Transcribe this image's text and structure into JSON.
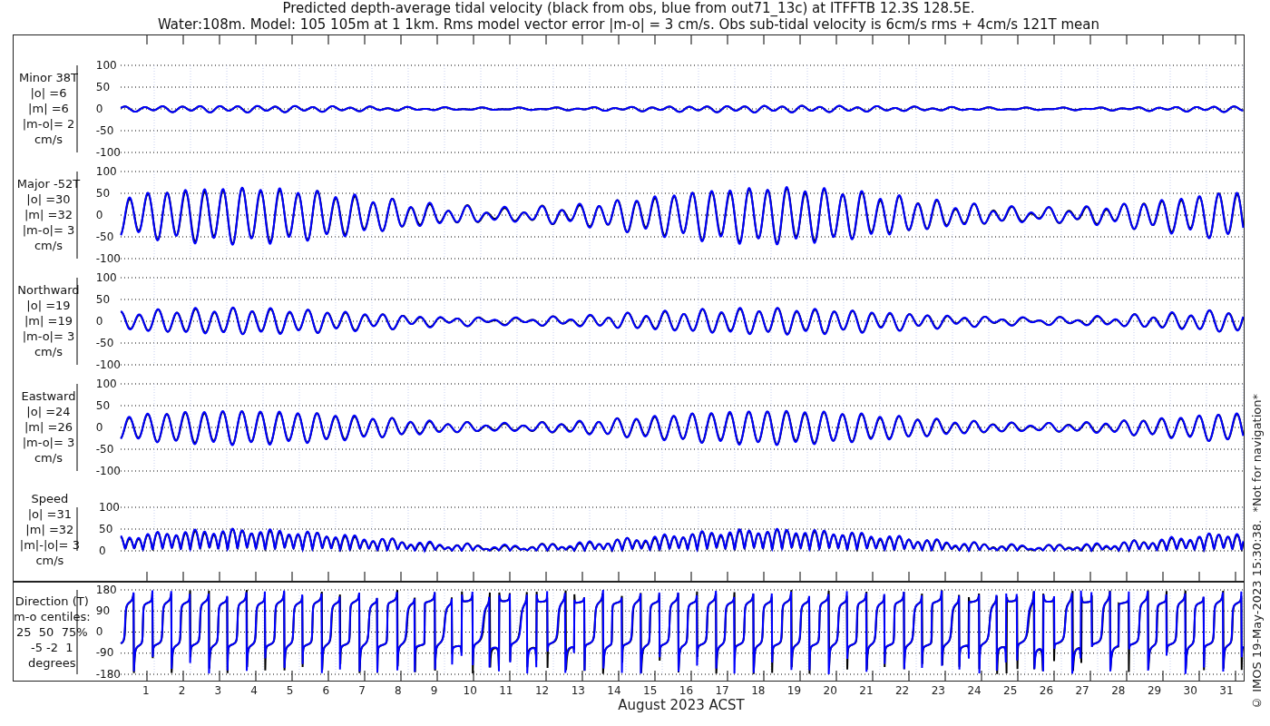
{
  "title_lines": [
    "Predicted depth-average tidal velocity (black from obs, blue from out71_13c) at ITFFTB 12.3S 128.5E.",
    "Water:108m. Model: 105 105m at 1 1km. Rms model vector error |m-o| = 3 cm/s. Obs sub-tidal velocity is 6cm/s rms + 4cm/s 121T mean"
  ],
  "panels": [
    {
      "kind": "minor",
      "label_lines": [
        "Minor 38T",
        "|o| =6",
        "|m| =6",
        "|m-o|= 2",
        "cm/s"
      ],
      "yticks": [
        "100",
        "50",
        "0",
        "-50",
        "-100"
      ]
    },
    {
      "kind": "major",
      "label_lines": [
        "Major -52T",
        "|o| =30",
        "|m| =32",
        "|m-o|= 3",
        "cm/s"
      ],
      "yticks": [
        "100",
        "50",
        "0",
        "-50",
        "-100"
      ]
    },
    {
      "kind": "north",
      "label_lines": [
        "Northward",
        "|o| =19",
        "|m| =19",
        "|m-o|= 3",
        "cm/s"
      ],
      "yticks": [
        "100",
        "50",
        "0",
        "-50",
        "-100"
      ]
    },
    {
      "kind": "east",
      "label_lines": [
        "Eastward",
        "|o| =24",
        "|m| =26",
        "|m-o|= 3",
        "cm/s"
      ],
      "yticks": [
        "100",
        "50",
        "0",
        "-50",
        "-100"
      ]
    },
    {
      "kind": "speed",
      "label_lines": [
        "Speed",
        "|o| =31",
        "|m| =32",
        "|m|-|o|= 3",
        "cm/s"
      ],
      "yticks": [
        "100",
        "50",
        "0"
      ]
    },
    {
      "kind": "direction",
      "label_lines": [
        "Direction (T)",
        "m-o centiles:",
        "25  50  75%",
        "-5 -2  1",
        "degrees"
      ],
      "yticks": [
        "180",
        "90",
        "0",
        "-90",
        "-180"
      ]
    }
  ],
  "x_axis": {
    "day_labels": [
      "1",
      "2",
      "3",
      "4",
      "5",
      "6",
      "7",
      "8",
      "9",
      "10",
      "11",
      "12",
      "13",
      "14",
      "15",
      "16",
      "17",
      "18",
      "19",
      "20",
      "21",
      "22",
      "23",
      "24",
      "25",
      "26",
      "27",
      "28",
      "29",
      "30",
      "31"
    ],
    "title": "August 2023 ACST"
  },
  "footer_note": "© IMOS 19-May-2023 15:30:38.  *Not for navigation*"
}
